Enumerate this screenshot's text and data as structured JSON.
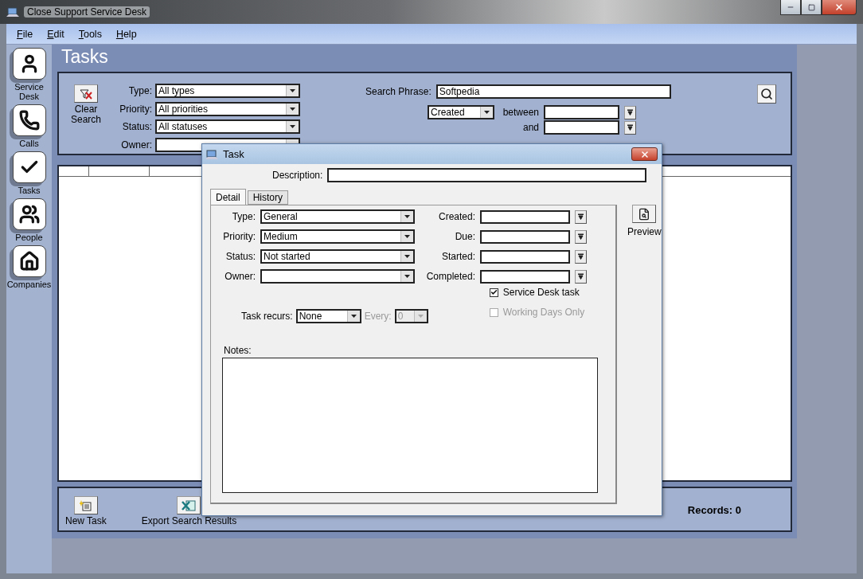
{
  "window": {
    "title": "Close Support Service Desk"
  },
  "menu": [
    "File",
    "Edit",
    "Tools",
    "Help"
  ],
  "sidebar": [
    {
      "label": "Service Desk"
    },
    {
      "label": "Calls"
    },
    {
      "label": "Tasks"
    },
    {
      "label": "People"
    },
    {
      "label": "Companies"
    }
  ],
  "page_title": "Tasks",
  "search": {
    "clear_label": "Clear Search",
    "filters": [
      {
        "label": "Type:",
        "value": "All types"
      },
      {
        "label": "Priority:",
        "value": "All priorities"
      },
      {
        "label": "Status:",
        "value": "All statuses"
      },
      {
        "label": "Owner:"
      }
    ],
    "phrase_label": "Search Phrase:",
    "phrase": "Softpedia",
    "date_field": "Created",
    "between_label": "between",
    "and_label": "and"
  },
  "footer": {
    "buttons": [
      "New Task",
      "Export Search Results"
    ],
    "records": "Records: 0"
  },
  "dialog": {
    "title": "Task",
    "description_label": "Description:",
    "tabs": [
      {
        "label": "Detail",
        "selected": true
      },
      {
        "label": "History",
        "selected": false
      }
    ],
    "fields": [
      {
        "label": "Type:",
        "value": "General"
      },
      {
        "label": "Priority:",
        "value": "Medium"
      },
      {
        "label": "Status:",
        "value": "Not started"
      },
      {
        "label": "Owner:"
      }
    ],
    "dates": [
      "Created:",
      "Due:",
      "Started:",
      "Completed:"
    ],
    "checkboxes": [
      {
        "label": "Service Desk task",
        "checked": true,
        "disabled": false
      },
      {
        "label": "Working Days Only",
        "checked": false,
        "disabled": true
      }
    ],
    "recurs": {
      "label": "Task recurs:",
      "value": "None",
      "every_label": "Every:",
      "every_value": "0",
      "every_disabled": true
    },
    "notes_label": "Notes:",
    "preview_label": "Preview"
  }
}
